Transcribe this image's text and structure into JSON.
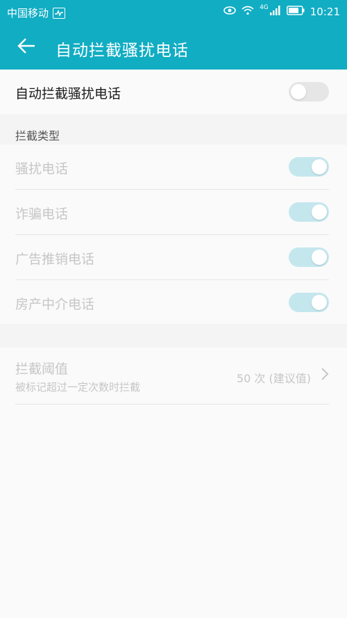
{
  "statusbar": {
    "carrier": "中国移动",
    "network": "4G",
    "time": "10:21"
  },
  "appbar": {
    "title": "自动拦截骚扰电话"
  },
  "master": {
    "label": "自动拦截骚扰电话",
    "enabled": false
  },
  "section": {
    "header": "拦截类型"
  },
  "types": [
    {
      "label": "骚扰电话",
      "enabled": true
    },
    {
      "label": "诈骗电话",
      "enabled": true
    },
    {
      "label": "广告推销电话",
      "enabled": true
    },
    {
      "label": "房产中介电话",
      "enabled": true
    }
  ],
  "threshold": {
    "title": "拦截阈值",
    "subtitle": "被标记超过一定次数时拦截",
    "value": "50 次 (建议值)"
  },
  "colors": {
    "accent": "#11adc3",
    "toggle_on": "#c4e7ee",
    "toggle_off": "#e6e6e6"
  }
}
